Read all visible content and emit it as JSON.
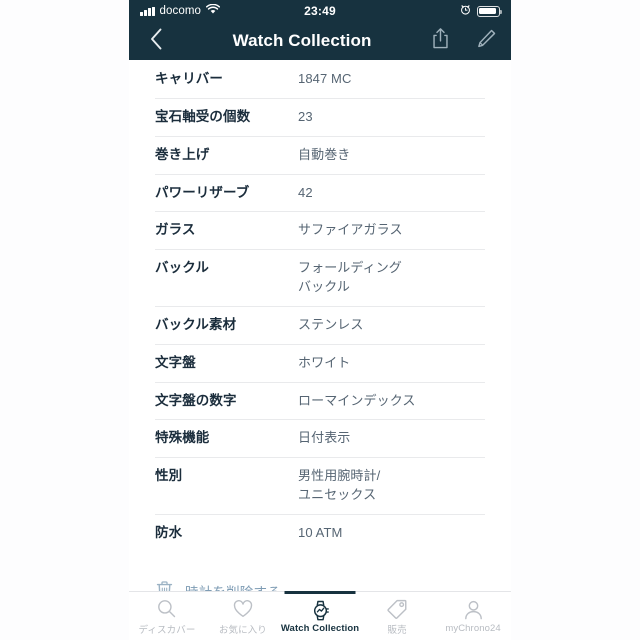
{
  "status_bar": {
    "carrier": "docomo",
    "time": "23:49",
    "signal_icon": "signal-bars-icon",
    "wifi_icon": "wifi-icon",
    "alarm_icon": "alarm-clock-icon",
    "battery_icon": "battery-icon"
  },
  "nav_bar": {
    "back_icon": "chevron-left-icon",
    "title": "Watch Collection",
    "share_icon": "share-icon",
    "edit_icon": "pencil-icon"
  },
  "specs": {
    "rows": [
      {
        "label": "キャリバー",
        "value": "1847 MC"
      },
      {
        "label": "宝石軸受の個数",
        "value": "23"
      },
      {
        "label": "巻き上げ",
        "value": "自動巻き"
      },
      {
        "label": "パワーリザーブ",
        "value": "42"
      },
      {
        "label": "ガラス",
        "value": "サファイアガラス"
      },
      {
        "label": "バックル",
        "value": "フォールディング\nバックル"
      },
      {
        "label": "バックル素材",
        "value": "ステンレス"
      },
      {
        "label": "文字盤",
        "value": "ホワイト"
      },
      {
        "label": "文字盤の数字",
        "value": "ローマインデックス"
      },
      {
        "label": "特殊機能",
        "value": "日付表示"
      },
      {
        "label": "性別",
        "value": "男性用腕時計/\nユニセックス"
      },
      {
        "label": "防水",
        "value": "10 ATM"
      }
    ]
  },
  "delete_action": {
    "icon": "trash-icon",
    "label": "時計を削除する"
  },
  "tab_bar": {
    "tabs": [
      {
        "label": "ディスカバー",
        "icon": "search-icon",
        "active": false
      },
      {
        "label": "お気に入り",
        "icon": "heart-icon",
        "active": false
      },
      {
        "label": "Watch Collection",
        "icon": "watch-icon",
        "active": true
      },
      {
        "label": "販売",
        "icon": "tag-icon",
        "active": false
      },
      {
        "label": "myChrono24",
        "icon": "person-icon",
        "active": false
      }
    ]
  },
  "colors": {
    "header_bg": "#17323f",
    "label_text": "#1b2d3c",
    "value_text": "#566573",
    "delete_text": "#7e9cb4",
    "inactive_tab": "#b8bcc2",
    "page_bg": "#fdfdfe"
  }
}
